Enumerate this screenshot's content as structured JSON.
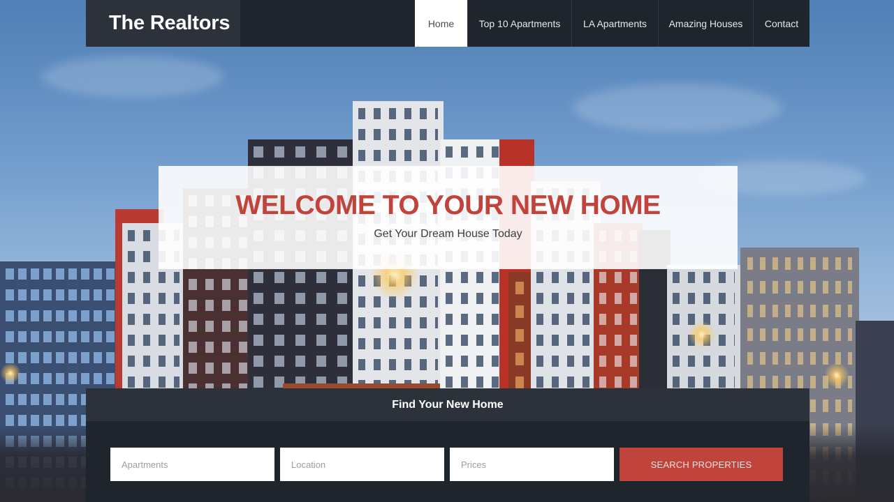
{
  "brand": {
    "name": "The Realtors"
  },
  "nav": {
    "items": [
      {
        "label": "Home",
        "active": true
      },
      {
        "label": "Top 10 Apartments",
        "active": false
      },
      {
        "label": "LA Apartments",
        "active": false
      },
      {
        "label": "Amazing Houses",
        "active": false
      },
      {
        "label": "Contact",
        "active": false
      }
    ]
  },
  "hero": {
    "title": "WELCOME TO YOUR NEW HOME",
    "subtitle": "Get Your Dream House Today"
  },
  "search": {
    "heading": "Find Your New Home",
    "fields": [
      {
        "placeholder": "Apartments",
        "value": ""
      },
      {
        "placeholder": "Location",
        "value": ""
      },
      {
        "placeholder": "Prices",
        "value": ""
      }
    ],
    "button_label": "SEARCH PROPERTIES"
  },
  "colors": {
    "accent": "#c0443c",
    "header_bg": "#1f252d",
    "brand_bg": "#2c323a"
  }
}
